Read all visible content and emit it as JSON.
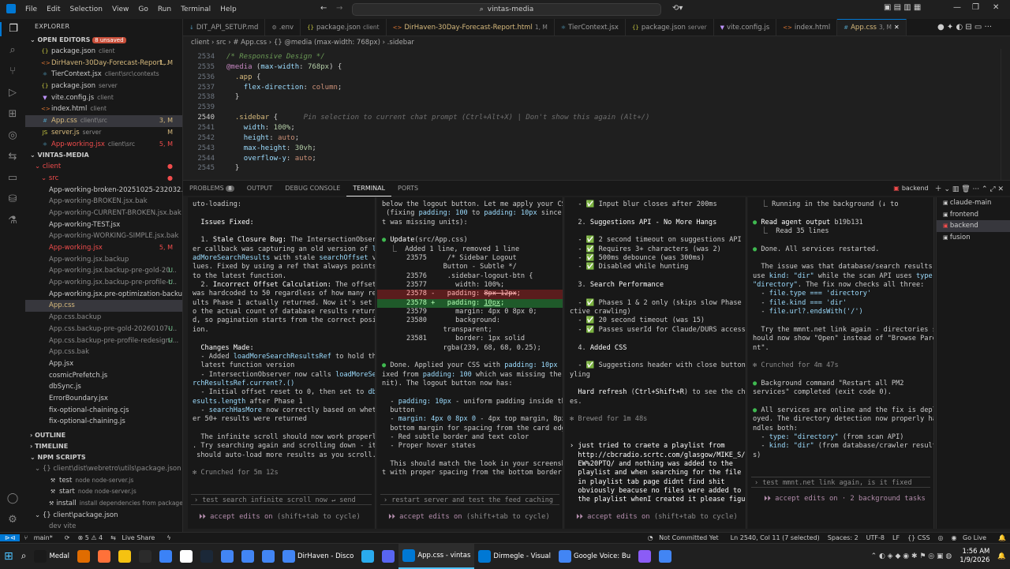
{
  "menu": [
    "File",
    "Edit",
    "Selection",
    "View",
    "Go",
    "Run",
    "Terminal",
    "Help"
  ],
  "search": "vintas-media",
  "tabs": [
    {
      "label": "DIT_API_SETUP.md",
      "desc": "",
      "icon": "↓",
      "color": "#519aba"
    },
    {
      "label": ".env",
      "desc": "",
      "icon": "⚙",
      "color": "#8b8b8b"
    },
    {
      "label": "package.json",
      "desc": "client",
      "icon": "{}",
      "color": "#cbcb41"
    },
    {
      "label": "DirHaven-30Day-Forecast-Report.html",
      "desc": "1, M",
      "icon": "<>",
      "color": "#e37933"
    },
    {
      "label": "TierContext.jsx",
      "desc": "",
      "icon": "⚛",
      "color": "#519aba"
    },
    {
      "label": "package.json",
      "desc": "server",
      "icon": "{}",
      "color": "#cbcb41"
    },
    {
      "label": "vite.config.js",
      "desc": "",
      "icon": "▼",
      "color": "#bd93f9"
    },
    {
      "label": "index.html",
      "desc": "",
      "icon": "<>",
      "color": "#e37933"
    },
    {
      "label": "App.css",
      "desc": "3, M",
      "icon": "#",
      "color": "#519aba",
      "active": true
    }
  ],
  "breadcrumb": "client › src › # App.css › {} @media (max-width: 768px) › .sidebar",
  "explorer": {
    "header": "EXPLORER",
    "open_editors": "OPEN EDITORS",
    "unsaved": "8 unsaved",
    "open_files": [
      {
        "icon": "{}",
        "name": "package.json",
        "desc": "client",
        "status": "",
        "color": "#cbcb41",
        "ncolor": "#cccccc"
      },
      {
        "icon": "<>",
        "name": "DirHaven-30Day-Forecast-Report...",
        "desc": "",
        "status": "1, M",
        "color": "#e37933",
        "ncolor": "#d7ba7d"
      },
      {
        "icon": "⚛",
        "name": "TierContext.jsx",
        "desc": "client\\src\\contexts",
        "status": "",
        "color": "#519aba",
        "ncolor": "#cccccc"
      },
      {
        "icon": "{}",
        "name": "package.json",
        "desc": "server",
        "status": "",
        "color": "#cbcb41",
        "ncolor": "#cccccc"
      },
      {
        "icon": "▼",
        "name": "vite.config.js",
        "desc": "client",
        "status": "",
        "color": "#bd93f9",
        "ncolor": "#cccccc"
      },
      {
        "icon": "<>",
        "name": "index.html",
        "desc": "client",
        "status": "",
        "color": "#e37933",
        "ncolor": "#cccccc"
      },
      {
        "icon": "#",
        "name": "App.css",
        "desc": "client\\src",
        "status": "3, M",
        "color": "#519aba",
        "ncolor": "#d7ba7d",
        "sel": true
      },
      {
        "icon": "JS",
        "name": "server.js",
        "desc": "server",
        "status": "M",
        "color": "#cbcb41",
        "ncolor": "#d7ba7d"
      },
      {
        "icon": "⚛",
        "name": "App-working.jsx",
        "desc": "client\\src",
        "status": "5, M",
        "color": "#519aba",
        "ncolor": "#f14c4c"
      }
    ],
    "project": "VINTAS-MEDIA",
    "client": "client",
    "src": "src",
    "src_files": [
      {
        "icon": "",
        "name": "App-working-broken-20251025-232032.jsx",
        "status": "",
        "ncolor": "#cccccc"
      },
      {
        "icon": "",
        "name": "App-working-BROKEN.jsx.bak",
        "status": "",
        "ncolor": "#8b8b8b"
      },
      {
        "icon": "",
        "name": "App-working-CURRENT-BROKEN.jsx.bak",
        "status": "",
        "ncolor": "#8b8b8b"
      },
      {
        "icon": "",
        "name": "App-working-TEST.jsx",
        "status": "",
        "ncolor": "#cccccc"
      },
      {
        "icon": "",
        "name": "App-working-WORKING-SIMPLE.jsx.bak",
        "status": "",
        "ncolor": "#8b8b8b"
      },
      {
        "icon": "",
        "name": "App-working.jsx",
        "status": "5, M",
        "ncolor": "#f14c4c"
      },
      {
        "icon": "",
        "name": "App-working.jsx.backup",
        "status": "",
        "ncolor": "#8b8b8b"
      },
      {
        "icon": "",
        "name": "App-working.jsx.backup-pre-gold-20...",
        "status": "U",
        "ncolor": "#8b8b8b"
      },
      {
        "icon": "",
        "name": "App-working.jsx.backup-pre-profile-r...",
        "status": "U",
        "ncolor": "#8b8b8b"
      },
      {
        "icon": "",
        "name": "App-working.jsx.pre-optimization-backup",
        "status": "",
        "ncolor": "#cccccc"
      },
      {
        "icon": "#",
        "name": "App.css",
        "status": "",
        "ncolor": "#d7ba7d",
        "sel": true
      },
      {
        "icon": "",
        "name": "App.css.backup",
        "status": "",
        "ncolor": "#8b8b8b"
      },
      {
        "icon": "",
        "name": "App.css.backup-pre-gold-20260107-...",
        "status": "U",
        "ncolor": "#8b8b8b"
      },
      {
        "icon": "",
        "name": "App.css.backup-pre-profile-redesign-...",
        "status": "U",
        "ncolor": "#8b8b8b"
      },
      {
        "icon": "",
        "name": "App.css.bak",
        "status": "",
        "ncolor": "#8b8b8b"
      },
      {
        "icon": "",
        "name": "App.jsx",
        "status": "",
        "ncolor": "#cccccc"
      },
      {
        "icon": "",
        "name": "cosmicPrefetch.js",
        "status": "",
        "ncolor": "#cccccc"
      },
      {
        "icon": "",
        "name": "dbSync.js",
        "status": "",
        "ncolor": "#cccccc"
      },
      {
        "icon": "",
        "name": "ErrorBoundary.jsx",
        "status": "",
        "ncolor": "#cccccc"
      },
      {
        "icon": "",
        "name": "fix-optional-chaining.cjs",
        "status": "",
        "ncolor": "#cccccc"
      },
      {
        "icon": "",
        "name": "fix-optional-chaining.js",
        "status": "",
        "ncolor": "#cccccc"
      }
    ],
    "outline": "OUTLINE",
    "timeline": "TIMELINE",
    "npm_scripts": "NPM SCRIPTS",
    "npm_path": "client\\dist\\webretro\\utils\\package.json",
    "npm_items": [
      {
        "name": "test",
        "desc": "node node-server.js"
      },
      {
        "name": "start",
        "desc": "node node-server.js"
      },
      {
        "name": "install",
        "desc": "install dependencies from package"
      }
    ],
    "npm_path2": "client\\package.json",
    "npm_dev": "dev  vite"
  },
  "editor": {
    "lines": [
      {
        "n": "2534",
        "html": "<span class='cm'>/* Responsive Design */</span>"
      },
      {
        "n": "2535",
        "html": "<span class='kw'>@media</span> (<span class='prop'>max-width</span>: <span class='num'>768px</span>) {"
      },
      {
        "n": "2536",
        "html": "  <span class='sel2'>.app</span> {"
      },
      {
        "n": "2537",
        "html": "    <span class='prop'>flex-direction</span>: <span class='val'>column</span>;"
      },
      {
        "n": "2538",
        "html": "  }"
      },
      {
        "n": "2539",
        "html": ""
      },
      {
        "n": "2540",
        "html": "  <span class='sel2'>.sidebar</span> {      <span class='ghost'>Pin selection to current chat prompt (Ctrl+Alt+X) | Don't show this again (Alt+/)</span>",
        "cur": true
      },
      {
        "n": "2541",
        "html": "    <span class='prop'>width</span>: <span class='num'>100%</span>;"
      },
      {
        "n": "2542",
        "html": "    <span class='prop'>height</span>: <span class='val'>auto</span>;"
      },
      {
        "n": "2543",
        "html": "    <span class='prop'>max-height</span>: <span class='num'>30vh</span>;"
      },
      {
        "n": "2544",
        "html": "    <span class='prop'>overflow-y</span>: <span class='val'>auto</span>;"
      },
      {
        "n": "2545",
        "html": "  }"
      }
    ]
  },
  "panel": {
    "tabs": [
      "PROBLEMS",
      "OUTPUT",
      "DEBUG CONSOLE",
      "TERMINAL",
      "PORTS"
    ],
    "problems_count": "8",
    "terminal_name": "backend"
  },
  "terminals": {
    "t1": [
      "uto-loading:",
      "",
      "  <span class='w'>Issues Fixed:</span>",
      "",
      "  1. <span class='w'>Stale Closure Bug:</span> The IntersectionObserv",
      "er callback was capturing an old version of <span class='bl'>lo</span>",
      "<span class='bl'>adMoreSearchResults</span> with stale <span class='bl'>searchOffset</span> va",
      "lues. Fixed by using a ref that always points",
      "to the latest function.",
      "  2. <span class='w'>Incorrect Offset Calculation:</span> The offset",
      "was hardcoded to 50 regardless of how many res",
      "ults Phase 1 actually returned. Now it's set t",
      "o the actual count of database results returne",
      "d, so pagination starts from the correct posit",
      "ion.",
      "",
      "  <span class='w'>Changes Made:</span>",
      "  - Added <span class='bl'>loadMoreSearchResultsRef</span> to hold the",
      "  latest function version",
      "  - IntersectionObserver now calls <span class='bl'>loadMoreSea</span>",
      "<span class='bl'>rchResultsRef.current?.()</span>",
      "  - Initial offset reset to 0, then set to <span class='bl'>dbR</span>",
      "<span class='bl'>esults.length</span> after Phase 1",
      "  - <span class='bl'>searchHasMore</span> now correctly based on wheth",
      "er 50+ results were returned",
      "",
      "  The infinite scroll should now work properly",
      ". Try searching again and scrolling down - it",
      " should auto-load more results as you scroll.",
      "",
      "<span class='dim'>✻ Crunched for 5m 12s</span>"
    ],
    "t1_prompt": "› test search infinite scroll now         ↵ send",
    "t2": [
      "below the logout button. Let me apply your CSS",
      " (fixing <span class='bl'>padding: 100</span> to <span class='bl'>padding: 10px</span> since i",
      "t was missing units):",
      "",
      "<span class='gr'>●</span> <span class='w'>Update</span>(src/App.css)",
      "  ⎿  Added 1 line, removed 1 line",
      "      23575     /* Sidebar Logout",
      "               Button - Subtle */",
      "      23576     .sidebar-logout-btn {",
      "      23577       width: 100%;",
      "@@DEL      23578 -   padding: <s>8px 12px</s>;",
      "@@ADD      23578 +   padding: <u>10px</u>;",
      "      23579       margin: 4px 0 8px 0;",
      "      23580       background:",
      "               transparent;",
      "      23581       border: 1px solid",
      "               rgba(239, 68, 68, 0.25);",
      "",
      "<span class='gr'>●</span> Done. Applied your CSS with <span class='bl'>padding: 10px</span> (f",
      "ixed from <span class='bl'>padding: 100</span> which was missing the u",
      "nit). The logout button now has:",
      "",
      "  - <span class='bl'>padding: 10px</span> - uniform padding inside the",
      "  button",
      "  - <span class='bl'>margin: 4px 0 8px 0</span> - 4px top margin, 8px",
      "  bottom margin for spacing from the card edge",
      "  - Red subtle border and text color",
      "  - Proper hover states",
      "",
      "  This should match the look in your screensho",
      "t with proper spacing from the bottom border."
    ],
    "t2_prompt": "› restart server and test the feed caching",
    "t3": [
      "  - <span class='gr'>✅</span> Input blur closes after 200ms",
      "",
      "  2. <span class='w'>Suggestions API - No More Hangs</span>",
      "",
      "  - <span class='gr'>✅</span> 2 second timeout on suggestions API",
      "  - <span class='gr'>✅</span> Requires 3+ characters (was 2)",
      "  - <span class='gr'>✅</span> 500ms debounce (was 300ms)",
      "  - <span class='gr'>✅</span> Disabled while hunting",
      "",
      "  3. <span class='w'>Search Performance</span>",
      "",
      "  - <span class='gr'>✅</span> Phases 1 & 2 only (skips slow Phase 3 a",
      "ctive crawling)",
      "  - <span class='gr'>✅</span> 20 second timeout (was 15)",
      "  - <span class='gr'>✅</span> Passes userId for Claude/DURS access",
      "",
      "  4. <span class='w'>Added CSS</span>",
      "",
      "  - <span class='gr'>✅</span> Suggestions header with close button st",
      "yling",
      "",
      "  <span class='w'>Hard refresh</span> (<span class='w'>Ctrl+Shift+R</span>) to see the chang",
      "es.",
      "",
      "<span class='dim'>✻ Brewed for 1m 48s</span>",
      "",
      "",
      "<span class='w'>› just tried to craete a playlist from</span>",
      "<span class='w'>  http://cbcradio.scrtc.com/glasgow/MIKE_S/N</span>",
      "<span class='w'>  EW%20PTQ/ and nothing was added to the</span>",
      "<span class='w'>  playlist and when searching for the file</span>",
      "<span class='w'>  in playlist tab page didnt find shit</span>",
      "<span class='w'>  obviously beacuse no files were added to</span>",
      "<span class='w'>  the playlist whenI created it please figu</span>"
    ],
    "t4": [
      "  ⎿ Running in the background (↓ to",
      "",
      "<span class='gr'>●</span> <span class='w'>Read agent output</span> b19b131",
      "  ⎿  Read 35 lines",
      "",
      "<span class='gr'>●</span> Done. All services restarted.",
      "",
      "  The issue was that database/search results",
      "use <span class='bl'>kind: \"dir\"</span> while the scan API uses <span class='bl'>type:</span>",
      "<span class='bl'>\"directory\"</span>. The fix now checks all three:",
      "  - <span class='bl'>file.type === 'directory'</span>",
      "  - <span class='bl'>file.kind === 'dir'</span>",
      "  - <span class='bl'>file.url?.endsWith('/')</span>",
      "",
      "  Try the mmnt.net link again - directories s",
      "hould now show \"Open\" instead of \"Browse Pare",
      "nt\".",
      "",
      "<span class='dim'>✻ Crunched for 4m 47s</span>",
      "",
      "<span class='gr'>●</span> Background command \"Restart all PM2",
      "services\" completed (exit code 0).",
      "",
      "<span class='gr'>●</span> All services are online and the fix is depl",
      "oyed. The directory detection now properly ha",
      "ndles both:",
      "  - <span class='bl'>type: \"directory\"</span> (from scan API)",
      "  - <span class='bl'>kind: \"dir\"</span> (from database/crawler result",
      "s)"
    ],
    "t4_prompt": "› test mmnt.net link again, is it fixed",
    "accept": "⏵⏵ accept edits on",
    "accept_tail": " (shift+tab to cycle)",
    "accept4": "⏵⏵ accept edits on · 2 background tasks",
    "list": [
      "claude-main",
      "frontend",
      "backend",
      "fusion"
    ]
  },
  "status": {
    "branch": "main*",
    "errors": "⊗ 5 ⚠ 4",
    "share": "Live Share",
    "not_committed": "Not Committed Yet",
    "position": "Ln 2540, Col 11 (7 selected)",
    "spaces": "Spaces: 2",
    "encoding": "UTF-8",
    "eol": "LF",
    "lang": "{} CSS",
    "golive": "Go Live"
  },
  "taskbar": {
    "items": [
      {
        "label": "Medal",
        "color": "#1a1a1a"
      },
      {
        "label": "",
        "color": "#e06c00"
      },
      {
        "label": "",
        "color": "#ff7139"
      },
      {
        "label": "",
        "color": "#f5c211"
      },
      {
        "label": "",
        "color": "#2b2b2b"
      },
      {
        "label": "",
        "color": "#3b82f6"
      },
      {
        "label": "",
        "color": "#ffffff"
      },
      {
        "label": "",
        "color": "#1b2838"
      },
      {
        "label": "",
        "color": "#4285f4"
      },
      {
        "label": "",
        "color": "#4285f4"
      },
      {
        "label": "",
        "color": "#4285f4"
      },
      {
        "label": "DirHaven - Disco",
        "color": "#4285f4"
      },
      {
        "label": "",
        "color": "#2aabee"
      },
      {
        "label": "",
        "color": "#5865f2"
      },
      {
        "label": "App.css - vintas",
        "color": "#0078d4",
        "active": true
      },
      {
        "label": "Dirmegle - Visual",
        "color": "#0078d4"
      },
      {
        "label": "Google Voice: Bu",
        "color": "#4285f4"
      },
      {
        "label": "",
        "color": "#8b5cf6"
      },
      {
        "label": "",
        "color": "#4285f4"
      }
    ],
    "time": "1:56 AM",
    "date": "1/9/2026"
  }
}
